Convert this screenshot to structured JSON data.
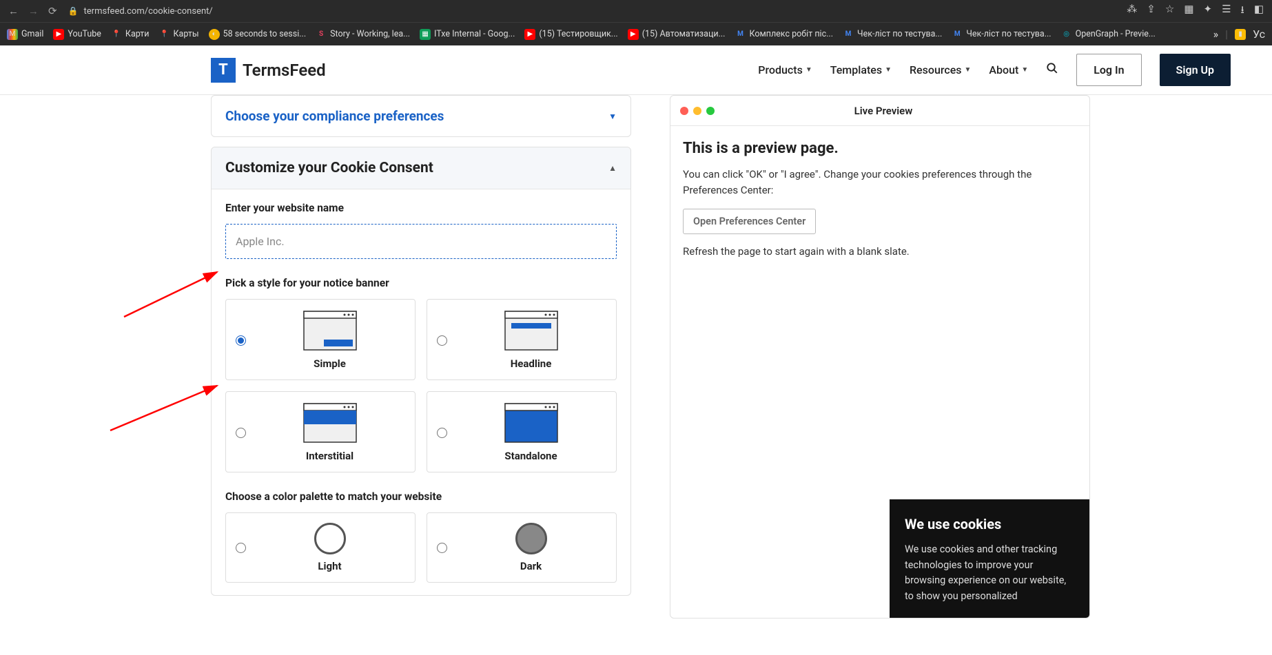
{
  "browser": {
    "url": "termsfeed.com/cookie-consent/"
  },
  "bookmarks": [
    {
      "label": "Gmail",
      "color": "#ea4335"
    },
    {
      "label": "YouTube",
      "color": "#ff0000"
    },
    {
      "label": "Карти",
      "color": "#34a853"
    },
    {
      "label": "Карты",
      "color": "#34a853"
    },
    {
      "label": "58 seconds to sessi...",
      "color": "#f4b400"
    },
    {
      "label": "Story - Working, lea...",
      "color": "#e4405f"
    },
    {
      "label": "ІТхе Internal - Goog...",
      "color": "#0f9d58"
    },
    {
      "label": "(15) Тестировщик...",
      "color": "#ff0000"
    },
    {
      "label": "(15) Автоматизаци...",
      "color": "#ff0000"
    },
    {
      "label": "Комплекс робіт піс...",
      "color": "#4285f4"
    },
    {
      "label": "Чек-ліст по тестува...",
      "color": "#4285f4"
    },
    {
      "label": "Чек-ліст по тестува...",
      "color": "#4285f4"
    },
    {
      "label": "OpenGraph - Previe...",
      "color": "#00bcd4"
    }
  ],
  "bookmarks_more": "»",
  "bookmarks_tail": "Ус",
  "nav": {
    "products": "Products",
    "templates": "Templates",
    "resources": "Resources",
    "about": "About",
    "login": "Log In",
    "signup": "Sign Up"
  },
  "logo": "TermsFeed",
  "panel1": "Choose your compliance preferences",
  "panel2_title": "Customize your Cookie Consent",
  "form": {
    "website_label": "Enter your website name",
    "website_placeholder": "Apple Inc.",
    "style_label": "Pick a style for your notice banner",
    "styles": {
      "simple": "Simple",
      "headline": "Headline",
      "interstitial": "Interstitial",
      "standalone": "Standalone"
    },
    "color_label": "Choose a color palette to match your website",
    "colors": {
      "light": "Light",
      "dark": "Dark"
    }
  },
  "preview": {
    "title": "Live Preview",
    "heading": "This is a preview page.",
    "text": "You can click \"OK\" or \"I agree\". Change your cookies preferences through the Preferences Center:",
    "button": "Open Preferences Center",
    "refresh": "Refresh the page to start again with a blank slate."
  },
  "cookie": {
    "heading": "We use cookies",
    "text": "We use cookies and other tracking technologies to improve your browsing experience on our website, to show you personalized"
  }
}
